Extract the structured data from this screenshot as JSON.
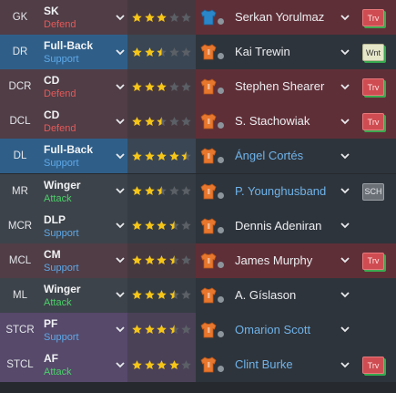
{
  "colors": {
    "star": "#f5c518",
    "star_empty": "#5b5f66",
    "duty_defend": "#e45a5a",
    "duty_support": "#5ea8e8",
    "duty_attack": "#4cd06a",
    "badge_outline": "#37be55"
  },
  "rows": [
    {
      "pos": "GK",
      "role": "SK",
      "duty": "Defend",
      "duty_type": "defend",
      "stars": 3,
      "player": "Serkan Yorulmaz",
      "shirt": "goalkeeper-shirt-icon",
      "name_style": "normal",
      "badge": "Trv",
      "badge_type": "trv",
      "theme": "red"
    },
    {
      "pos": "DR",
      "role": "Full-Back",
      "duty": "Support",
      "duty_type": "support",
      "stars": 2.5,
      "player": "Kai Trewin",
      "shirt": "outfield-shirt-icon",
      "name_style": "normal",
      "badge": "Wnt",
      "badge_type": "wnt",
      "theme": "blue"
    },
    {
      "pos": "DCR",
      "role": "CD",
      "duty": "Defend",
      "duty_type": "defend",
      "stars": 3,
      "player": "Stephen Shearer",
      "shirt": "outfield-shirt-icon",
      "name_style": "normal",
      "badge": "Trv",
      "badge_type": "trv",
      "theme": "red"
    },
    {
      "pos": "DCL",
      "role": "CD",
      "duty": "Defend",
      "duty_type": "defend",
      "stars": 2.5,
      "player": "S. Stachowiak",
      "shirt": "outfield-shirt-icon",
      "name_style": "normal",
      "badge": "Trv",
      "badge_type": "trv",
      "theme": "red"
    },
    {
      "pos": "DL",
      "role": "Full-Back",
      "duty": "Support",
      "duty_type": "support",
      "stars": 4.5,
      "player": "Ángel Cortés",
      "shirt": "outfield-shirt-icon",
      "name_style": "blue",
      "badge": "",
      "badge_type": "",
      "theme": "blue"
    },
    {
      "pos": "MR",
      "role": "Winger",
      "duty": "Attack",
      "duty_type": "attack",
      "stars": 2.5,
      "player": "P. Younghusband",
      "shirt": "outfield-shirt-icon",
      "name_style": "blue",
      "badge": "SCH",
      "badge_type": "sch",
      "theme": "gray"
    },
    {
      "pos": "MCR",
      "role": "DLP",
      "duty": "Support",
      "duty_type": "support",
      "stars": 3.5,
      "player": "Dennis Adeniran",
      "shirt": "outfield-shirt-icon",
      "name_style": "normal",
      "badge": "",
      "badge_type": "",
      "theme": "gray"
    },
    {
      "pos": "MCL",
      "role": "CM",
      "duty": "Support",
      "duty_type": "support",
      "stars": 3.5,
      "player": "James Murphy",
      "shirt": "outfield-shirt-icon",
      "name_style": "normal",
      "badge": "Trv",
      "badge_type": "trv",
      "theme": "red"
    },
    {
      "pos": "ML",
      "role": "Winger",
      "duty": "Attack",
      "duty_type": "attack",
      "stars": 3.5,
      "player": "A. Gíslason",
      "shirt": "outfield-shirt-icon",
      "name_style": "normal",
      "badge": "",
      "badge_type": "",
      "theme": "gray"
    },
    {
      "pos": "STCR",
      "role": "PF",
      "duty": "Support",
      "duty_type": "support",
      "stars": 3.5,
      "player": "Omarion Scott",
      "shirt": "outfield-shirt-icon",
      "name_style": "blue",
      "badge": "",
      "badge_type": "",
      "theme": "purple"
    },
    {
      "pos": "STCL",
      "role": "AF",
      "duty": "Attack",
      "duty_type": "attack",
      "stars": 4,
      "player": "Clint Burke",
      "shirt": "outfield-shirt-icon",
      "name_style": "blue",
      "badge": "Trv",
      "badge_type": "trv",
      "theme": "purple"
    }
  ]
}
